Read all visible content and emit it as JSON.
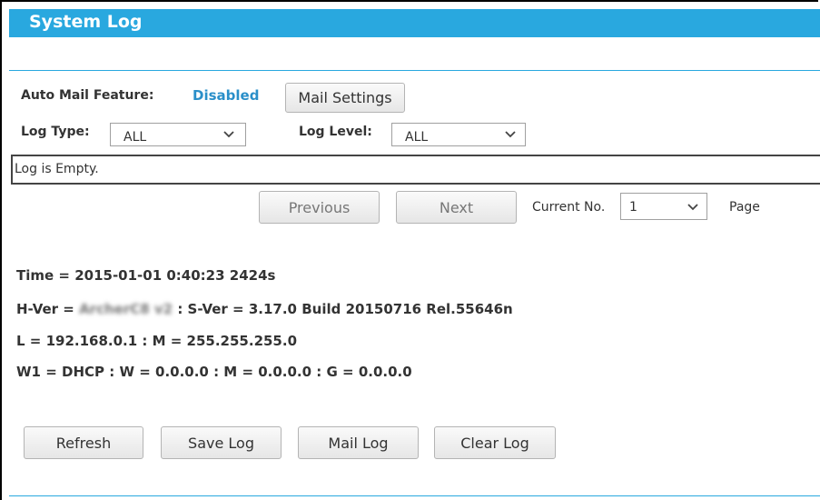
{
  "header": {
    "title": "System Log"
  },
  "mail": {
    "label": "Auto Mail Feature:",
    "status": "Disabled",
    "status_color": "#2a8fc9",
    "settings_button": "Mail Settings"
  },
  "filters": {
    "log_type_label": "Log Type:",
    "log_type_value": "ALL",
    "log_level_label": "Log Level:",
    "log_level_value": "ALL"
  },
  "log": {
    "text": "Log is Empty."
  },
  "pager": {
    "previous": "Previous",
    "next": "Next",
    "current_label": "Current No.",
    "current_value": "1",
    "page_label": "Page"
  },
  "info": {
    "time_line": "Time = 2015-01-01 0:40:23 2424s",
    "hver_prefix": "H-Ver = ",
    "hver_model_blurred": "ArcherC8 v2",
    "hver_suffix": " : S-Ver = 3.17.0 Build 20150716 Rel.55646n",
    "lan_line": "L = 192.168.0.1 : M = 255.255.255.0",
    "wan_line": "W1 = DHCP : W = 0.0.0.0 : M = 0.0.0.0 : G = 0.0.0.0"
  },
  "actions": {
    "refresh": "Refresh",
    "save_log": "Save Log",
    "mail_log": "Mail Log",
    "clear_log": "Clear Log"
  },
  "colors": {
    "accent": "#29a8df",
    "chevron": "#444444"
  },
  "icons": {
    "dropdown": "chevron-down-icon"
  }
}
